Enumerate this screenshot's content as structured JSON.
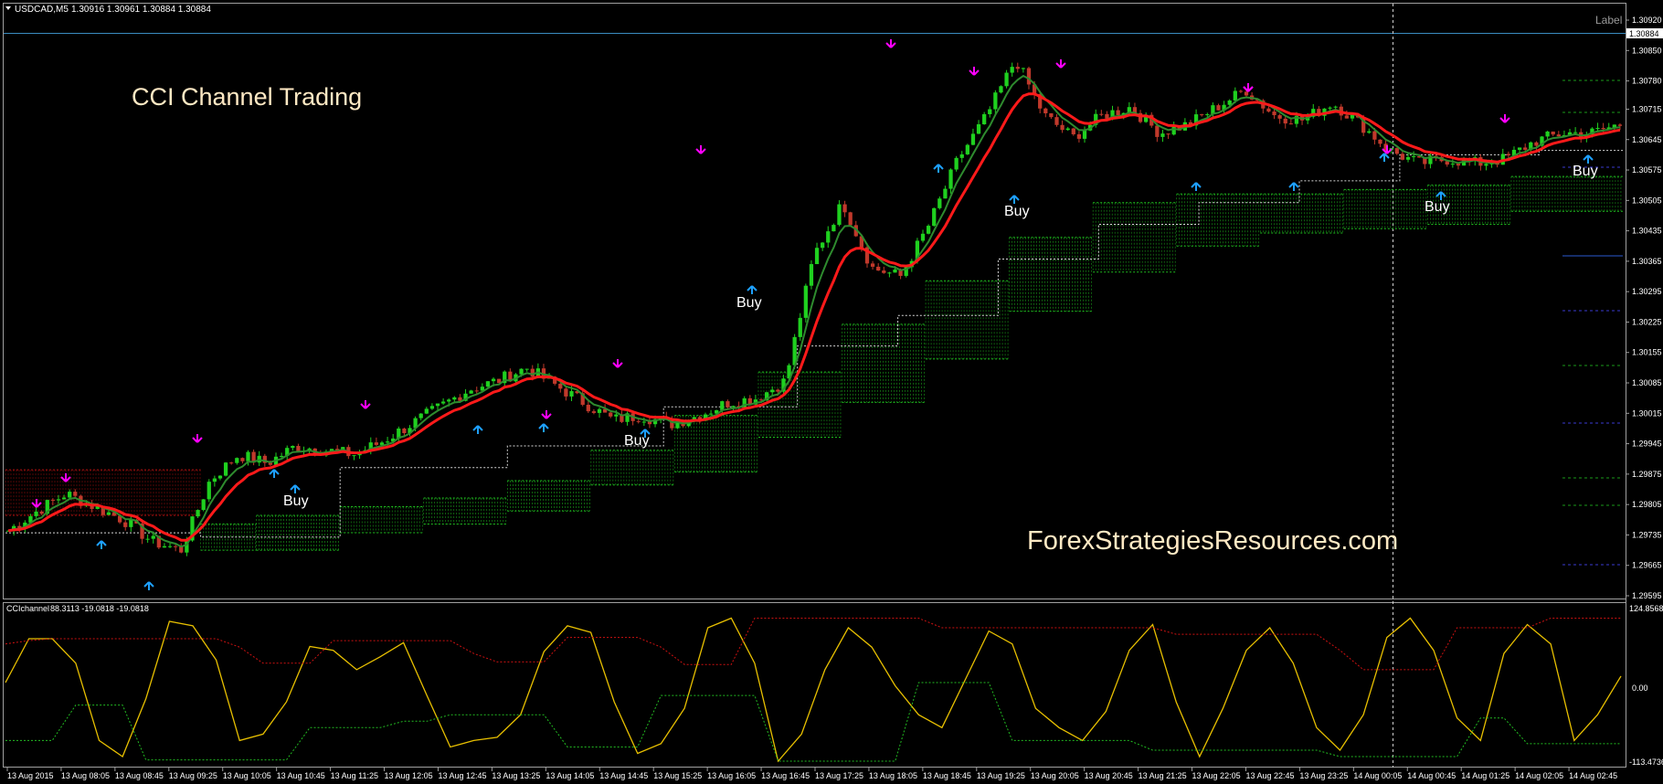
{
  "header": {
    "symbol": "USDCAD,M5",
    "ohlc": "1.30916 1.30961 1.30884 1.30884",
    "label": "Label"
  },
  "main": {
    "title": "CCI Channel Trading",
    "watermark": "ForexStrategiesResources.com",
    "current_price": "1.30884",
    "buy_label": "Buy"
  },
  "indicator": {
    "name": "CCIchannel",
    "values": "88.3113 -19.0818 -19.0818",
    "y_max_label": "124.8568",
    "y_zero_label": "0.00",
    "y_min_label": "-113.4736"
  },
  "colors": {
    "background": "#000000",
    "bull_candle": "#1fd01f",
    "bear_candle": "#c0392b",
    "ma_fast": "#ff1a1a",
    "ma_slow": "#2e8b2e",
    "buy_arrow": "#1ea0ff",
    "sell_arrow": "#ff00ff",
    "cloud": "#1fbf1f",
    "cloud_red": "#b01010",
    "cci_line": "#e8c000",
    "cci_upper": "#cc1111",
    "cci_lower": "#22bb22",
    "axis_text": "#ffffff"
  },
  "chart_data": [
    {
      "type": "line",
      "title": "CCI Channel Trading",
      "series_note": "candlestick price USDCAD M5 with moving averages",
      "ylim": [
        1.29595,
        1.3092
      ],
      "y_ticks": [
        "1.30920",
        "1.30850",
        "1.30780",
        "1.30715",
        "1.30645",
        "1.30575",
        "1.30505",
        "1.30435",
        "1.30365",
        "1.30295",
        "1.30225",
        "1.30155",
        "1.30085",
        "1.30015",
        "1.29945",
        "1.29875",
        "1.29805",
        "1.29735",
        "1.29665",
        "1.29595"
      ],
      "x_ticks": [
        "13 Aug 2015",
        "13 Aug 08:05",
        "13 Aug 08:45",
        "13 Aug 09:25",
        "13 Aug 10:05",
        "13 Aug 10:45",
        "13 Aug 11:25",
        "13 Aug 12:05",
        "13 Aug 12:45",
        "13 Aug 13:25",
        "13 Aug 14:05",
        "13 Aug 14:45",
        "13 Aug 15:25",
        "13 Aug 16:05",
        "13 Aug 16:45",
        "13 Aug 17:25",
        "13 Aug 18:05",
        "13 Aug 18:45",
        "13 Aug 19:25",
        "13 Aug 20:05",
        "13 Aug 20:45",
        "13 Aug 21:25",
        "13 Aug 22:05",
        "13 Aug 22:45",
        "13 Aug 23:25",
        "14 Aug 00:05",
        "14 Aug 00:45",
        "14 Aug 01:25",
        "14 Aug 02:05",
        "14 Aug 02:45"
      ],
      "close_path": [
        1.29745,
        1.2979,
        1.2983,
        1.298,
        1.2977,
        1.2972,
        1.297,
        1.2986,
        1.2992,
        1.299,
        1.2994,
        1.2993,
        1.2992,
        1.2995,
        1.2999,
        1.3003,
        1.3007,
        1.3009,
        1.3012,
        1.3008,
        1.3004,
        1.3,
        1.3001,
        1.2999,
        1.3001,
        1.3004,
        1.3005,
        1.3009,
        1.3038,
        1.305,
        1.3035,
        1.3033,
        1.3045,
        1.306,
        1.307,
        1.3083,
        1.307,
        1.3065,
        1.307,
        1.3072,
        1.3066,
        1.3068,
        1.3072,
        1.3076,
        1.307,
        1.3069,
        1.3073,
        1.3068,
        1.3062,
        1.3059,
        1.306,
        1.3059,
        1.306,
        1.3064,
        1.3066,
        1.3066,
        1.3068
      ]
    },
    {
      "type": "line",
      "title": "CCIchannel 88.3113 -19.0818 -19.0818",
      "ylim": [
        -113.4736,
        124.8568
      ],
      "series": [
        {
          "name": "CCI",
          "values": [
            10,
            78,
            78,
            40,
            -80,
            -105,
            -15,
            105,
            98,
            45,
            -80,
            -70,
            -20,
            66,
            60,
            30,
            50,
            72,
            -10,
            -90,
            -80,
            -75,
            -40,
            58,
            98,
            88,
            -20,
            -100,
            -85,
            -30,
            95,
            110,
            40,
            -112,
            -70,
            30,
            95,
            65,
            5,
            -40,
            -60,
            15,
            90,
            70,
            -30,
            -60,
            -80,
            -35,
            60,
            100,
            -20,
            -105,
            -30,
            60,
            95,
            40,
            -60,
            -95,
            -40,
            80,
            110,
            60,
            -45,
            -80,
            55,
            100,
            70,
            -80,
            -40,
            20
          ]
        },
        {
          "name": "Upper",
          "values": [
            70,
            75,
            78,
            78,
            78,
            78,
            78,
            78,
            78,
            78,
            65,
            40,
            40,
            40,
            75,
            75,
            75,
            75,
            75,
            75,
            55,
            42,
            42,
            42,
            80,
            80,
            80,
            80,
            65,
            38,
            38,
            38,
            110,
            110,
            110,
            110,
            110,
            110,
            110,
            110,
            95,
            95,
            95,
            95,
            95,
            95,
            95,
            95,
            95,
            95,
            85,
            85,
            85,
            85,
            85,
            85,
            85,
            60,
            30,
            30,
            30,
            30,
            95,
            95,
            95,
            95,
            110,
            110,
            110,
            110
          ]
        },
        {
          "name": "Lower",
          "values": [
            -80,
            -80,
            -80,
            -25,
            -25,
            -25,
            -110,
            -110,
            -110,
            -110,
            -110,
            -110,
            -110,
            -60,
            -60,
            -60,
            -60,
            -50,
            -50,
            -40,
            -40,
            -40,
            -40,
            -40,
            -90,
            -90,
            -90,
            -90,
            -10,
            -10,
            -10,
            -10,
            -10,
            -112,
            -112,
            -112,
            -112,
            -112,
            -112,
            10,
            10,
            10,
            10,
            -80,
            -80,
            -80,
            -80,
            -80,
            -80,
            -95,
            -95,
            -95,
            -95,
            -95,
            -95,
            -95,
            -95,
            -105,
            -105,
            -105,
            -105,
            -105,
            -105,
            -45,
            -45,
            -85,
            -85,
            -85,
            -85,
            -85
          ]
        }
      ]
    }
  ]
}
